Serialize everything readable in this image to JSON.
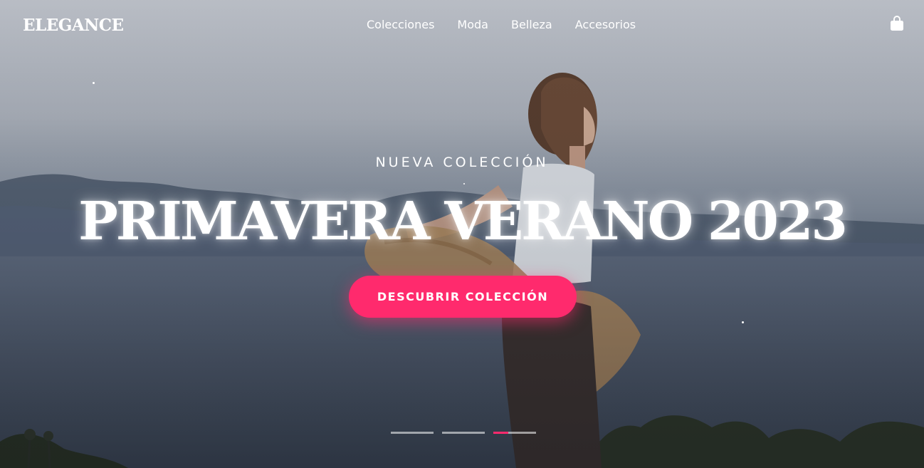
{
  "brand": {
    "logo_text": "ELEGANCE"
  },
  "nav": {
    "items": [
      {
        "label": "Colecciones"
      },
      {
        "label": "Moda"
      },
      {
        "label": "Belleza"
      },
      {
        "label": "Accesorios"
      }
    ]
  },
  "header": {
    "cart_icon": "shopping-bag-icon"
  },
  "hero": {
    "eyebrow": "NUEVA COLECCIÓN",
    "title": "PRIMAVERA VERANO 2023",
    "cta_label": "DESCUBRIR COLECCIÓN",
    "slides_total": 3,
    "active_slide": 3
  },
  "colors": {
    "accent": "#ff2a6d",
    "text": "#ffffff"
  }
}
